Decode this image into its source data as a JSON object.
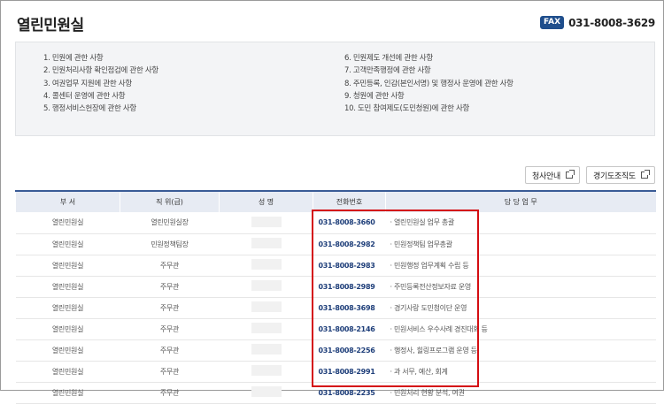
{
  "page": {
    "title": "열린민원실"
  },
  "fax": {
    "badge": "FAX",
    "number": "031-8008-3629"
  },
  "topics": {
    "left": [
      "1. 민원에 관한 사항",
      "2. 민원처리사항 확인점검에 관한 사항",
      "3. 여권업무 지원에 관한 사항",
      "4. 콜센터 운영에 관한 사항",
      "5. 행정서비스헌장에 관한 사항"
    ],
    "right": [
      "6. 민원제도 개선에 관한 사항",
      "7. 고객만족행정에 관한 사항",
      "8. 주민등록, 인감(본인서명) 및 행정사 운영에 관한 사항",
      "9. 청원에 관한 사항",
      "10. 도민 참여제도(도민청원)에 관한 사항"
    ]
  },
  "buttons": {
    "office_guide": "청사안내",
    "org_chart": "경기도조직도"
  },
  "table": {
    "headers": [
      "부 서",
      "직 위(급)",
      "성 명",
      "전화번호",
      "담 당 업 무"
    ],
    "rows": [
      {
        "dept": "열린민원실",
        "position": "열린민원실장",
        "phone": "031-8008-3660",
        "duty": "· 열린민원실 업무 총괄"
      },
      {
        "dept": "열린민원실",
        "position": "민원정책팀장",
        "phone": "031-8008-2982",
        "duty": "· 민원정책팀 업무총괄"
      },
      {
        "dept": "열린민원실",
        "position": "주무관",
        "phone": "031-8008-2983",
        "duty": "· 민원행정 업무계획 수립 등"
      },
      {
        "dept": "열린민원실",
        "position": "주무관",
        "phone": "031-8008-2989",
        "duty": "· 주민등록전산정보자료 운영"
      },
      {
        "dept": "열린민원실",
        "position": "주무관",
        "phone": "031-8008-3698",
        "duty": "· 경기사랑 도민청이단 운영"
      },
      {
        "dept": "열린민원실",
        "position": "주무관",
        "phone": "031-8008-2146",
        "duty": "· 민원서비스 우수사례 경진대회 등"
      },
      {
        "dept": "열린민원실",
        "position": "주무관",
        "phone": "031-8008-2256",
        "duty": "· 행정사, 힐링프로그램 운영 등"
      },
      {
        "dept": "열린민원실",
        "position": "주무관",
        "phone": "031-8008-2991",
        "duty": "· 과 서무, 예산, 회계"
      },
      {
        "dept": "열린민원실",
        "position": "주무관",
        "phone": "031-8008-2235",
        "duty": "· 민원처리 현황 분석, 여권"
      }
    ]
  },
  "colors": {
    "accent": "#1f4e8c",
    "highlight_box": "#d40d12",
    "phone_text": "#1f3f7a"
  }
}
